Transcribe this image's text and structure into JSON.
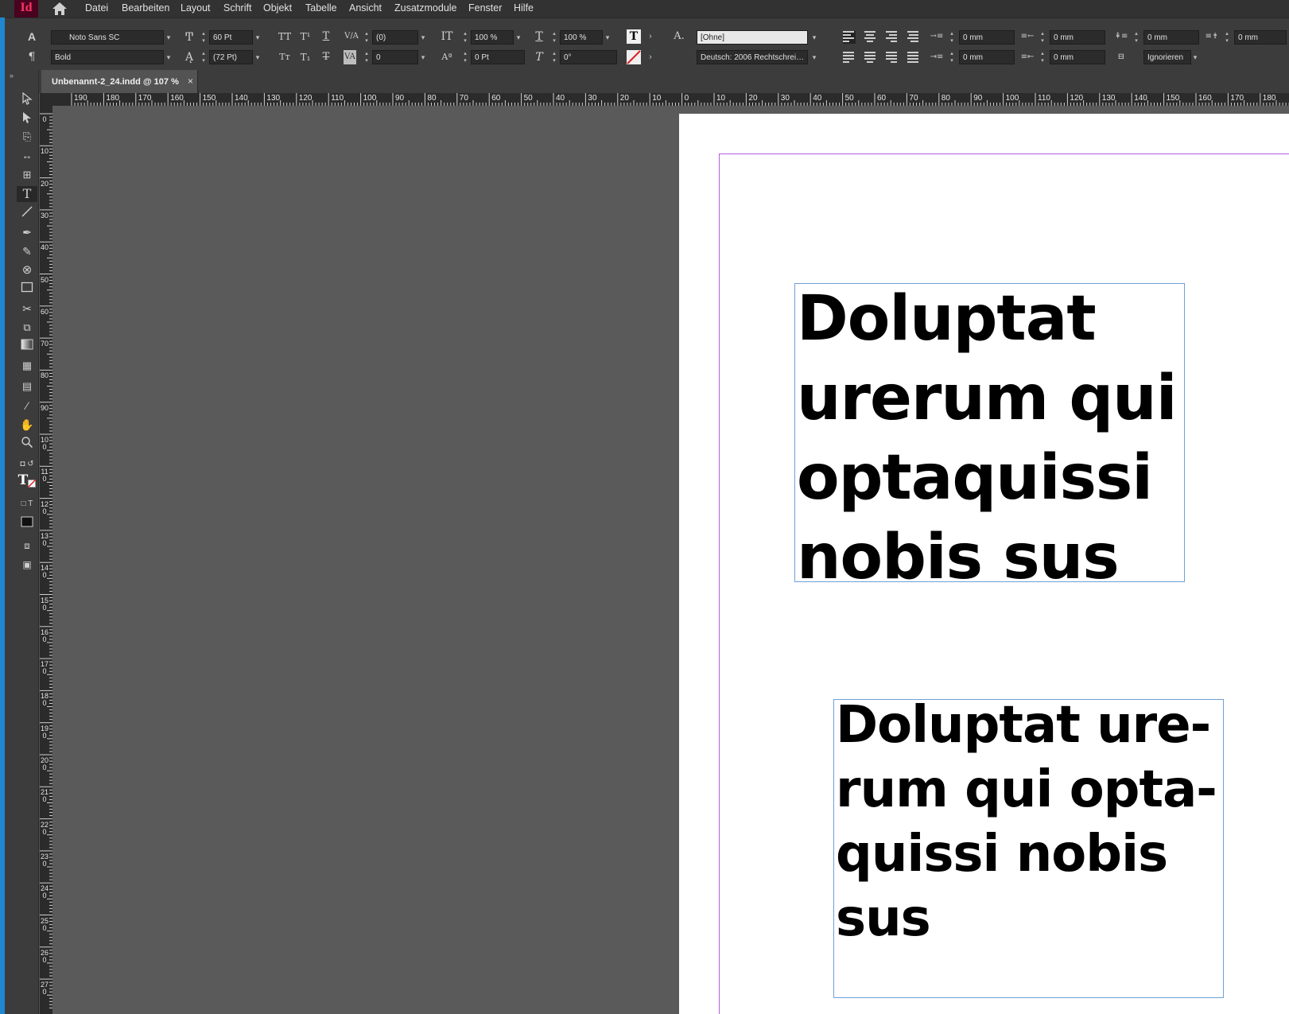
{
  "app": {
    "logo": "Id"
  },
  "menu": [
    "Datei",
    "Bearbeiten",
    "Layout",
    "Schrift",
    "Objekt",
    "Tabelle",
    "Ansicht",
    "Zusatzmodule",
    "Fenster",
    "Hilfe"
  ],
  "control": {
    "font_family": "Noto Sans SC",
    "font_style": "Bold",
    "font_size": "60 Pt",
    "leading": "(72 Pt)",
    "kerning": "(0)",
    "tracking": "0",
    "vertical_scale": "100 %",
    "baseline_shift": "0 Pt",
    "horizontal_scale": "100 %",
    "skew": "0°",
    "char_style": "[Ohne]",
    "language": "Deutsch: 2006 Rechtschrei…",
    "left_indent": "0 mm",
    "right_indent": "0 mm",
    "first_line_indent": "0 mm",
    "last_line_indent": "0 mm",
    "space_before": "0 mm",
    "space_after": "0 mm",
    "grid_align": "Ignorieren",
    "accent_color": "#49021f",
    "frame_color": "#6fa0d8",
    "margin_color": "#b25ee0"
  },
  "document": {
    "tab_label": "Unbenannt-2_24.indd @ 107 %",
    "close_glyph": "×"
  },
  "ruler": {
    "top": [
      "190",
      "180",
      "170",
      "160",
      "150",
      "140",
      "130",
      "120",
      "110",
      "100",
      "90",
      "80",
      "70",
      "60",
      "50",
      "40",
      "30",
      "20",
      "10",
      "0",
      "10",
      "20",
      "30",
      "40",
      "50",
      "60",
      "70",
      "80",
      "90",
      "100",
      "110",
      "120",
      "130",
      "140",
      "150",
      "160",
      "170",
      "180"
    ],
    "left": [
      "0",
      "10",
      "20",
      "30",
      "40",
      "50",
      "60",
      "70",
      "80",
      "90",
      "100",
      "110",
      "120",
      "130",
      "140",
      "150",
      "160",
      "170",
      "180",
      "190",
      "200",
      "210",
      "220",
      "230",
      "240",
      "250",
      "260",
      "270"
    ]
  },
  "frames": {
    "frame1_text": "Doluptat urerum qui optaquissi nobis sus",
    "frame2_lines": [
      "Doluptat ure-",
      "rum qui opta-",
      "quissi nobis",
      "sus"
    ]
  }
}
